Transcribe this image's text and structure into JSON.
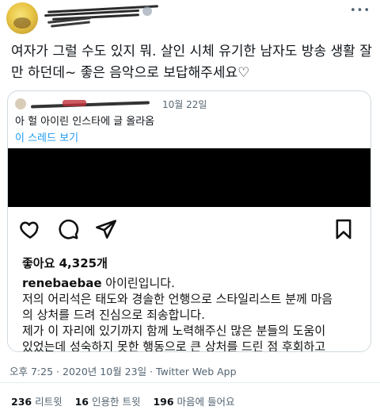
{
  "tweet": {
    "body": "여자가 그럴 수도 있지 뭐. 살인 시체 유기한 남자도 방송 생활 잘만 하던데~ 좋은 음악으로 보답해주세요♡",
    "more_icon": "more-horizontal-icon"
  },
  "quote": {
    "date": "10월 22일",
    "text": "아 헐 아이린 인스타에 글 올라옴",
    "thread_link": "이 스레드 보기"
  },
  "instagram": {
    "likes": "좋아요 4,325개",
    "username": "renebaebae",
    "caption_first": "아이린입니다.",
    "caption_lines": [
      "저의 어리석은 태도와 경솔한 언행으로 스타일리스트 분께 마음",
      "의 상처를 드려 진심으로 죄송합니다.",
      "제가 이 자리에 있기까지 함께 노력해주신 많은 분들의 도움이",
      "있었는데 성숙하지 못한 행동으로 큰 상처를 드린 점 후회하고"
    ]
  },
  "meta": {
    "time": "오후 7:25",
    "date": "2020년 10월 23일",
    "source": "Twitter Web App",
    "separator": "·"
  },
  "stats": {
    "retweets_count": "236",
    "retweets_label": "리트윗",
    "quotes_count": "16",
    "quotes_label": "인용한 트윗",
    "likes_count": "196",
    "likes_label": "마음에 들어요"
  }
}
